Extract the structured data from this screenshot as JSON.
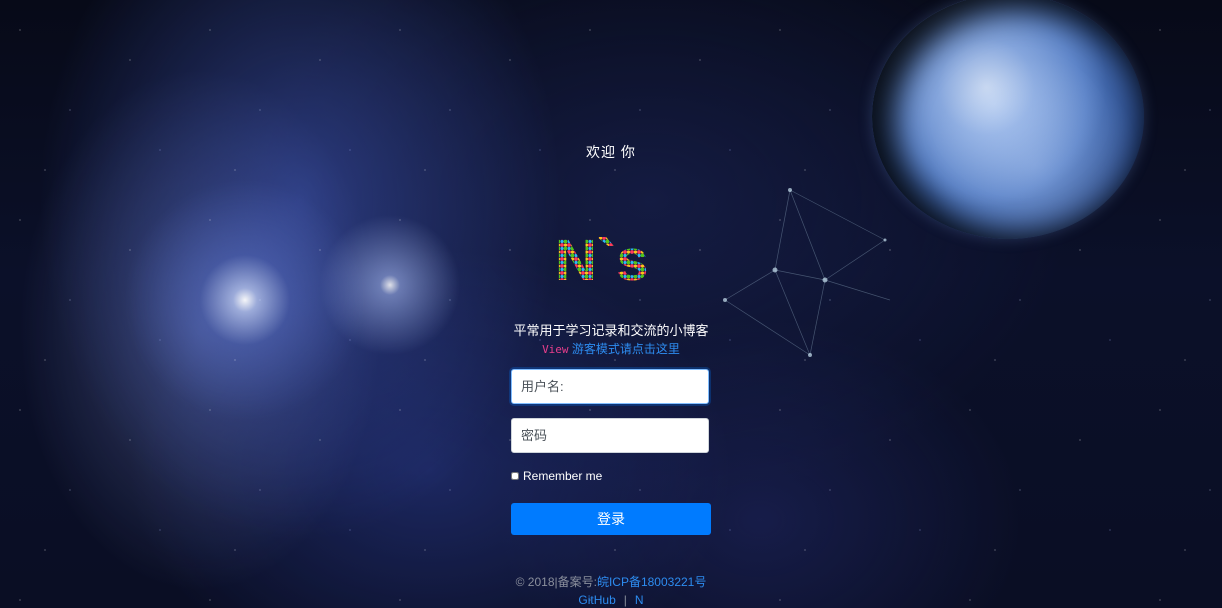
{
  "header": {
    "welcome": "欢迎 你"
  },
  "logo": {
    "text": "N`s"
  },
  "intro": {
    "slogan": "平常用于学习记录和交流的小博客",
    "view_label": "View",
    "visitor_link": "游客模式请点击这里"
  },
  "form": {
    "username_placeholder": "用户名:",
    "password_placeholder": "密码",
    "remember_label": "Remember me",
    "remember_checked": false,
    "login_label": "登录"
  },
  "footer": {
    "copyright": "© 2018|备案号:",
    "icp_link": "皖ICP备18003221号",
    "github_link": "GitHub",
    "separator": "|",
    "n_link": "N"
  },
  "colors": {
    "primary": "#007bff",
    "link": "#2d8cf0",
    "view_accent": "#e83e8c"
  }
}
